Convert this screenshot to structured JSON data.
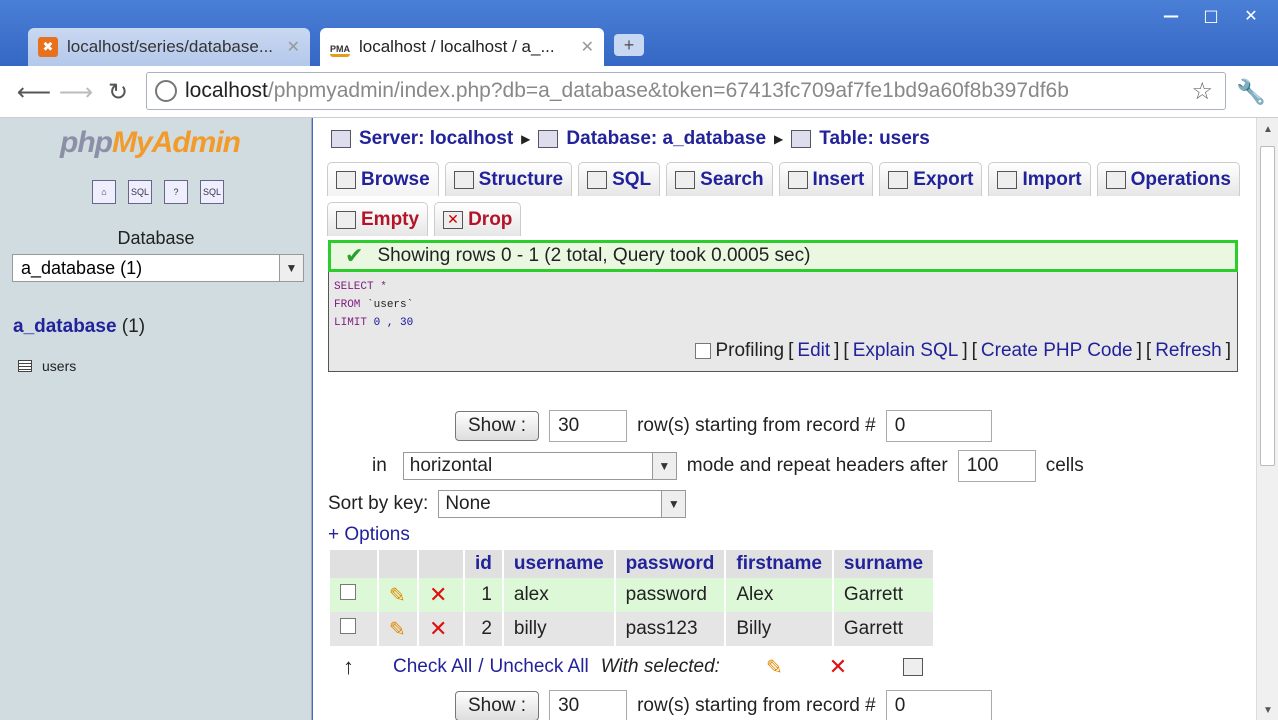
{
  "window": {
    "minimize": "—",
    "maximize": "□",
    "close": "✕"
  },
  "tabs": [
    {
      "title": "localhost/series/database...",
      "close": "✕",
      "favicon": "xampp-icon"
    },
    {
      "title": "localhost / localhost / a_...",
      "close": "✕",
      "favicon": "pma-icon",
      "fav_text": "PMA"
    }
  ],
  "new_tab": "+",
  "address": {
    "host": "localhost",
    "path": "/phpmyadmin/index.php?db=a_database&token=67413fc709af7fe1bd9a60f8b397df6b"
  },
  "left": {
    "logo": {
      "php": "php",
      "my": "My",
      "admin": "Admin"
    },
    "icons": [
      "home-icon",
      "sql-icon",
      "help-icon",
      "query-icon"
    ],
    "icon_labels": [
      "⌂",
      "SQL",
      "?",
      "SQL"
    ],
    "db_label": "Database",
    "db_select": "a_database (1)",
    "db_name": "a_database",
    "db_count": "(1)",
    "tables": [
      "users"
    ]
  },
  "breadcrumb": {
    "server": "Server: localhost",
    "database": "Database: a_database",
    "table": "Table: users"
  },
  "tabs_main": [
    "Browse",
    "Structure",
    "SQL",
    "Search",
    "Insert",
    "Export",
    "Import",
    "Operations"
  ],
  "tabs_danger": [
    "Empty",
    "Drop"
  ],
  "message": "Showing rows 0 - 1 (2 total, Query took 0.0005 sec)",
  "sql": {
    "line1": "SELECT *",
    "line2_kw": "FROM",
    "line2_str": "`users`",
    "line3_kw": "LIMIT",
    "line3_num": "0 , 30"
  },
  "sql_links": {
    "profiling": "Profiling",
    "edit": "Edit",
    "explain": "Explain SQL",
    "create_php": "Create PHP Code",
    "refresh": "Refresh"
  },
  "nav": {
    "show": "Show :",
    "rows": "30",
    "rows_text": "row(s) starting from record #",
    "start": "0",
    "in": "in",
    "mode": "horizontal",
    "mode_text": "mode and repeat headers after",
    "repeat": "100",
    "cells": "cells",
    "sort_label": "Sort by key:",
    "sort_value": "None",
    "options": "+ Options"
  },
  "table": {
    "columns": [
      "id",
      "username",
      "password",
      "firstname",
      "surname"
    ],
    "rows": [
      [
        "1",
        "alex",
        "password",
        "Alex",
        "Garrett"
      ],
      [
        "2",
        "billy",
        "pass123",
        "Billy",
        "Garrett"
      ]
    ]
  },
  "bulk": {
    "check_all": "Check All",
    "sep": "/",
    "uncheck_all": "Uncheck All",
    "with_selected": "With selected:"
  },
  "nav_bottom": {
    "show": "Show :",
    "rows": "30",
    "rows_text": "row(s) starting from record #",
    "start": "0"
  }
}
